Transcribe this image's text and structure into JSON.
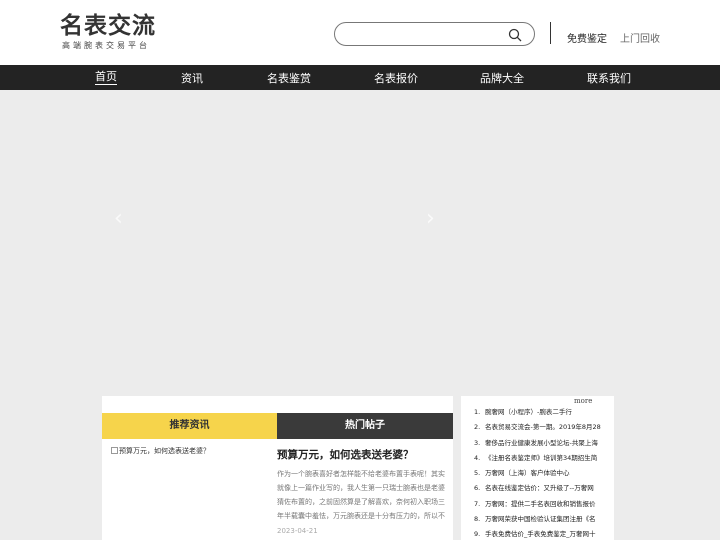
{
  "header": {
    "logo_title": "名表交流",
    "logo_subtitle": "高端腕表交易平台",
    "search_placeholder": "",
    "link_appraise": "免费鉴定",
    "link_recycle": "上门回收"
  },
  "nav": {
    "items": [
      "首页",
      "资讯",
      "名表鉴赏",
      "名表报价",
      "品牌大全",
      "联系我们"
    ],
    "active_index": 0
  },
  "banner": {
    "prev_arrow": "‹",
    "next_arrow": "›"
  },
  "panel": {
    "tab_recommended": "推荐资讯",
    "tab_hot": "热门帖子",
    "article": {
      "image_alt": "预算万元，如何选表送老婆？",
      "title": "预算万元，如何选表送老婆？",
      "description": "作为一个腕表喜好者怎样能不给老婆布置手表呢！其实就像上一篇作业写的，我人生第一只瑞士腕表也是老婆猜佐布置的，之前固然算是了解喜欢，奈何初入职场三年半载囊中羞怯，万元腕表还是十分有压力的，所以不时未曾入 ...",
      "date": "2023-04-21"
    }
  },
  "sidebar": {
    "more_label": "more",
    "items": [
      "腕奢网（小程序）-腕表二手行",
      "名表贸易交流会-第一期。2019年8月28",
      "奢侈品行业健康发展小型论坛-共聚上海",
      "《注册名表鉴定师》培训第34期招生简",
      "万奢网（上海）客户体验中心",
      "名表在线鉴定估价：又升级了--万奢网",
      "万奢网：提供二手名表回收和销售报价",
      "万奢网荣获中国检验认证集团注册《名",
      "手表免费估价_手表免费鉴定_万奢网十"
    ]
  },
  "colors": {
    "nav_bg": "#232323",
    "tab_recommended_bg": "#f6d44b",
    "tab_hot_bg": "#3a3a3a",
    "page_bg": "#ececec"
  },
  "icons": {
    "search": "search-icon",
    "prev": "chevron-left-icon",
    "next": "chevron-right-icon"
  }
}
